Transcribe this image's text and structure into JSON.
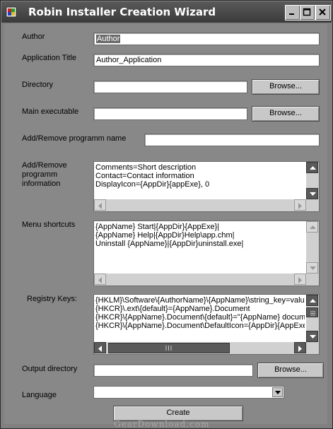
{
  "window": {
    "title": "Robin Installer Creation Wizard"
  },
  "fields": {
    "author": {
      "label": "Author",
      "value": "Author"
    },
    "app_title": {
      "label": "Application Title",
      "value": "Author_Application"
    },
    "directory": {
      "label": "Directory",
      "value": "",
      "browse": "Browse..."
    },
    "main_exe": {
      "label": "Main executable",
      "value": "",
      "browse": "Browse..."
    },
    "addremove_name": {
      "label": "Add/Remove programm name",
      "value": ""
    },
    "addremove_info": {
      "label": "Add/Remove programm information",
      "text": "Comments=Short description\nContact=Contact information\nDisplayIcon={AppDir}{appExe}, 0"
    },
    "menu_shortcuts": {
      "label": "Menu shortcuts",
      "text": "{AppName} Start|{AppDir}{AppExe}|\n{AppName} Help|{AppDir}Help\\app.chm|\nUninstall {AppName}|{AppDir}uninstall.exe|"
    },
    "registry_keys": {
      "label": "Registry Keys:",
      "text": "{HKLM}\\Software\\{AuthorName}\\{AppName}\\string_key=value\n{HKCR}\\.ext\\{default}={AppName}.Document\n{HKCR}\\{AppName}.Document\\{default}=\"{AppName} docum\n{HKCR}\\{AppName}.Document\\DefaultIcon={AppDir}{AppExe"
    },
    "output_dir": {
      "label": "Output directory",
      "value": "",
      "browse": "Browse..."
    },
    "language": {
      "label": "Language",
      "value": ""
    }
  },
  "actions": {
    "create": "Create"
  },
  "watermark": "GearDownload.com"
}
